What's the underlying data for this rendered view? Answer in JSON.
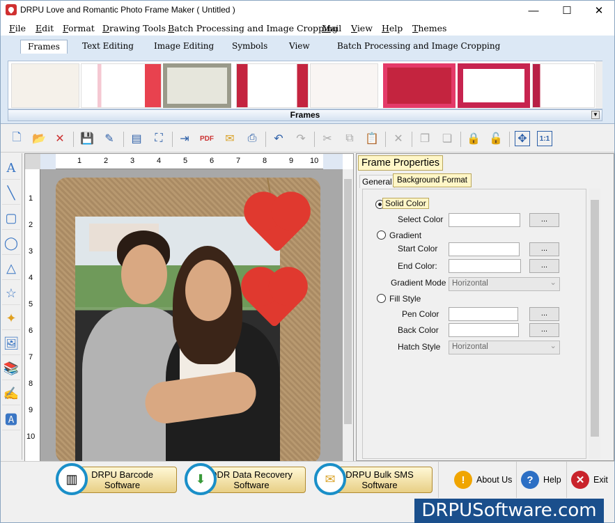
{
  "window": {
    "title": "DRPU Love and Romantic Photo Frame Maker ( Untitled )",
    "minimize": "—",
    "maximize": "☐",
    "close": "✕"
  },
  "menu": [
    "File",
    "Edit",
    "Format",
    "Drawing Tools",
    "Batch Processing and Image Cropping",
    "Mail",
    "View",
    "Help",
    "Themes"
  ],
  "ribbon": {
    "tabs": [
      "Frames",
      "Text Editing",
      "Image Editing",
      "Symbols",
      "View",
      "Batch Processing and Image Cropping"
    ],
    "active_tab": "Frames",
    "gallery_label": "Frames"
  },
  "ruler": {
    "top": [
      "1",
      "2",
      "3",
      "4",
      "5",
      "6",
      "7",
      "8",
      "9",
      "10"
    ],
    "left": [
      "1",
      "2",
      "3",
      "4",
      "5",
      "6",
      "7",
      "8",
      "9",
      "10"
    ]
  },
  "properties": {
    "title": "Frame Properties",
    "tabs": {
      "general": "General",
      "background": "Background Format"
    },
    "solid_color": "Solid Color",
    "select_color": "Select Color",
    "gradient": "Gradient",
    "start_color": "Start Color",
    "end_color": "End Color:",
    "gradient_mode": "Gradient Mode",
    "gradient_mode_value": "Horizontal",
    "fill_style": "Fill Style",
    "pen_color": "Pen Color",
    "back_color": "Back Color",
    "hatch_style": "Hatch Style",
    "hatch_style_value": "Horizontal",
    "browse": "..."
  },
  "bottom": {
    "promo1": {
      "line1": "DRPU Barcode",
      "line2": "Software"
    },
    "promo2": {
      "line1": "DDR Data Recovery",
      "line2": "Software"
    },
    "promo3": {
      "line1": "DRPU Bulk SMS",
      "line2": "Software"
    },
    "about": "About Us",
    "help": "Help",
    "exit": "Exit"
  },
  "brand": "DRPUSoftware.com",
  "colors": {
    "accent": "#1a8fc8",
    "highlight": "#fff6c7",
    "brand_bg": "#1a4f8c"
  }
}
